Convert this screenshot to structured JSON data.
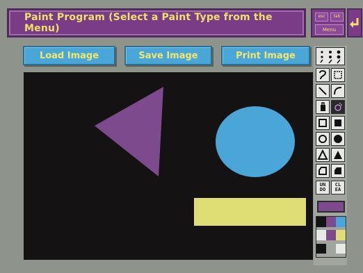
{
  "title_bar": {
    "title": "Paint Program (Select a Paint Type from the Menu)"
  },
  "system_buttons": {
    "esc_label": "esc",
    "tab_label": "tab",
    "menu_label": "Menu",
    "enter_icon": "enter-arrow-icon"
  },
  "actions": {
    "load_label": "Load Image",
    "save_label": "Save Image",
    "print_label": "Print Image"
  },
  "canvas": {
    "background_color": "#151214",
    "shapes": [
      {
        "type": "triangle",
        "color": "#7d4a8e"
      },
      {
        "type": "ellipse",
        "color": "#4aa6d6"
      },
      {
        "type": "rectangle",
        "color": "#dede74"
      }
    ]
  },
  "toolbox": {
    "tools": [
      {
        "name": "brush-sizes-icon"
      },
      {
        "name": "freehand-icon"
      },
      {
        "name": "rectangle-select-icon"
      },
      {
        "name": "line-icon"
      },
      {
        "name": "curve-icon"
      },
      {
        "name": "fill-bucket-icon"
      },
      {
        "name": "spray-icon"
      },
      {
        "name": "rectangle-outline-icon"
      },
      {
        "name": "rectangle-filled-icon"
      },
      {
        "name": "circle-outline-icon"
      },
      {
        "name": "circle-filled-icon"
      },
      {
        "name": "triangle-outline-icon"
      },
      {
        "name": "triangle-filled-icon"
      },
      {
        "name": "polygon-outline-icon"
      },
      {
        "name": "polygon-filled-icon"
      }
    ],
    "undo_label": "UN DO",
    "clear_label": "CL EA",
    "current_color": "#7d4a8e",
    "palette": [
      "#151214",
      "#7d4a8e",
      "#4aa6d6",
      "#e8e8e6",
      "#7d4a8e",
      "#dede74",
      "#151214",
      "#a0a69e",
      "#e8e8e6"
    ]
  },
  "colors": {
    "title_bg": "#7a3c86",
    "title_text": "#f0e06a",
    "button_bg": "#4aa6d6",
    "button_text": "#f2e66c",
    "window_bg": "#8e938c"
  }
}
